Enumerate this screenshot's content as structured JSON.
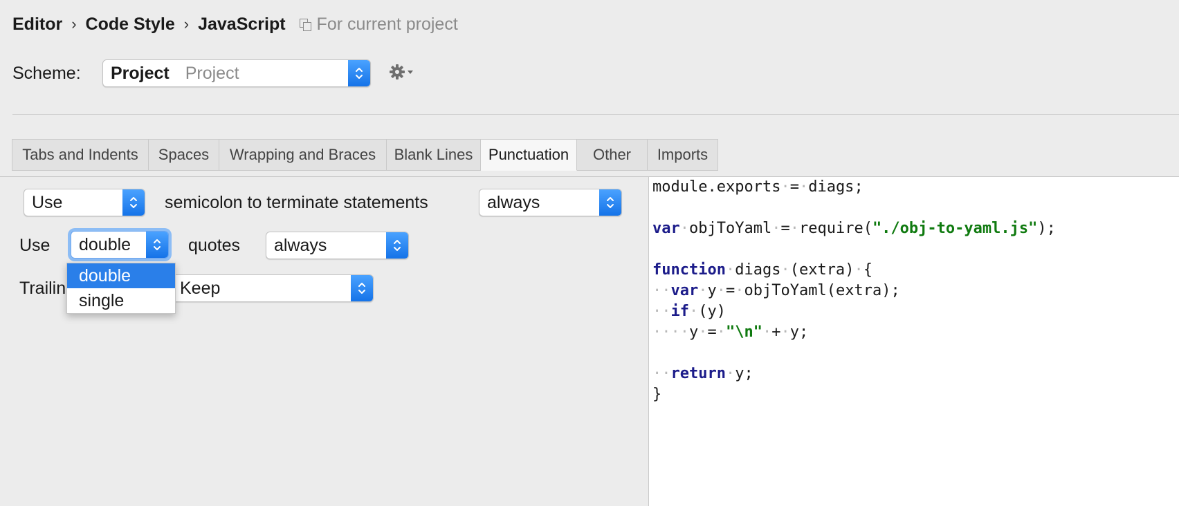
{
  "breadcrumb": {
    "items": [
      "Editor",
      "Code Style",
      "JavaScript"
    ],
    "separator": "›",
    "scope_label": "For current project"
  },
  "scheme": {
    "label": "Scheme:",
    "value_bold": "Project",
    "value_light": "Project"
  },
  "tabs": [
    {
      "label": "Tabs and Indents",
      "active": false
    },
    {
      "label": "Spaces",
      "active": false
    },
    {
      "label": "Wrapping and Braces",
      "active": false
    },
    {
      "label": "Blank Lines",
      "active": false
    },
    {
      "label": "Punctuation",
      "active": true
    },
    {
      "label": "Other",
      "active": false
    },
    {
      "label": "Imports",
      "active": false
    }
  ],
  "options": {
    "semicolon_mode": "Use",
    "semicolon_label": "semicolon to terminate statements",
    "semicolon_when": "always",
    "quotes_prefix": "Use",
    "quotes_value": "double",
    "quotes_label": "quotes",
    "quotes_when": "always",
    "trailing_label_visible": "Trailin",
    "trailing_value": "Keep"
  },
  "dropdown": {
    "options": [
      "double",
      "single"
    ],
    "selected": "double"
  },
  "code_lines": [
    "module.exports = diags;",
    "",
    "var objToYaml = require(\"./obj-to-yaml.js\");",
    "",
    "function diags (extra) {",
    "  var y = objToYaml(extra);",
    "  if (y)",
    "    y = \"\\n\" + y;",
    "",
    "  return y;",
    "}"
  ],
  "colors": {
    "accent": "#2a7fe9",
    "keyword": "#1c1c8a",
    "string": "#0f7a0f",
    "whitespace_dot": "#b8b8b8"
  },
  "icons": {
    "project_scope": "project-scope-icon",
    "gear": "gear-icon",
    "select_arrows": "chevron-updown-icon"
  }
}
